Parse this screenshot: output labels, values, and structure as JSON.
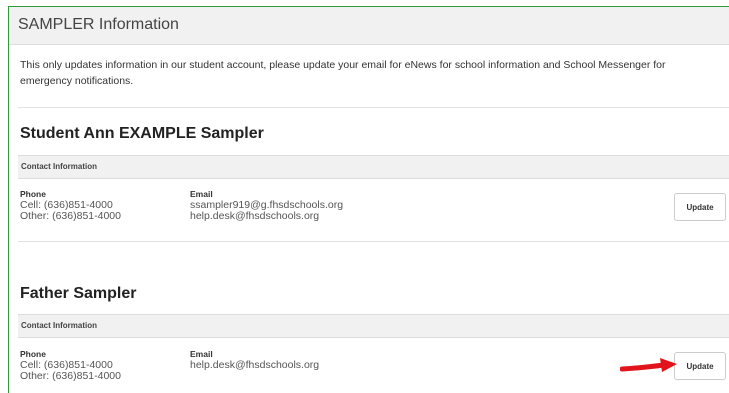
{
  "header": {
    "title": "SAMPLER Information"
  },
  "notice": "This only updates information in our student account, please update your email for eNews for school information and School Messenger for emergency notifications.",
  "people": [
    {
      "name": "Student Ann EXAMPLE Sampler",
      "contact_label": "Contact Information",
      "phone_label": "Phone",
      "phones": [
        "Cell: (636)851-4000",
        "Other: (636)851-4000"
      ],
      "email_label": "Email",
      "emails": [
        "ssampler919@g.fhsdschools.org",
        "help.desk@fhsdschools.org"
      ],
      "update_label": "Update"
    },
    {
      "name": "Father Sampler",
      "contact_label": "Contact Information",
      "phone_label": "Phone",
      "phones": [
        "Cell: (636)851-4000",
        "Other: (636)851-4000"
      ],
      "email_label": "Email",
      "emails": [
        "help.desk@fhsdschools.org"
      ],
      "update_label": "Update"
    }
  ],
  "colors": {
    "frame_border": "#2e9a3c",
    "annotation_arrow": "#e0141a"
  },
  "icons": {
    "annotation": "red-arrow-icon"
  }
}
